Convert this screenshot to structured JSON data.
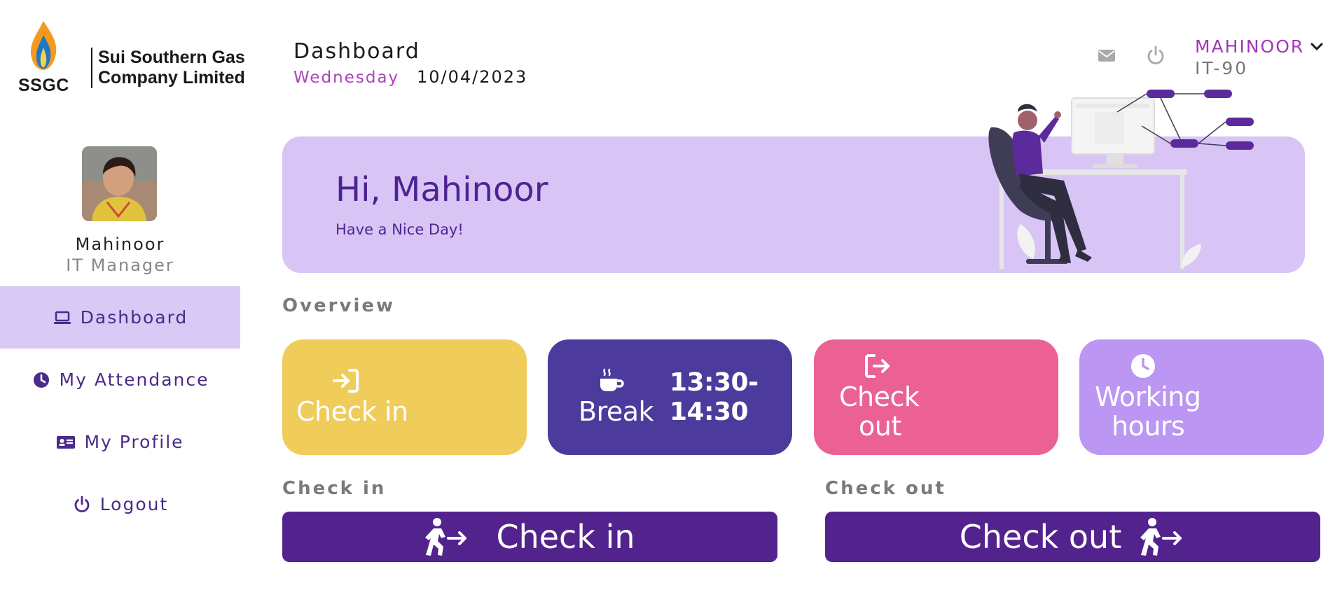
{
  "brand": {
    "abbr": "SSGC",
    "name_line1": "Sui Southern Gas",
    "name_line2": "Company Limited",
    "flame_outer": "#f59a1f",
    "flame_inner": "#1f78c8"
  },
  "profile": {
    "name": "Mahinoor",
    "role": "IT Manager"
  },
  "sidebar": {
    "items": [
      {
        "label": "Dashboard",
        "icon": "laptop-icon",
        "active": true
      },
      {
        "label": "My Attendance",
        "icon": "clock-icon",
        "active": false
      },
      {
        "label": "My Profile",
        "icon": "id-card-icon",
        "active": false
      },
      {
        "label": "Logout",
        "icon": "power-icon",
        "active": false
      }
    ]
  },
  "header": {
    "title": "Dashboard",
    "day": "Wednesday",
    "date": "10/04/2023",
    "user": "MAHINOOR",
    "code": "IT-90",
    "icons": [
      "mail-icon",
      "power-icon",
      "chevron-down-icon"
    ]
  },
  "banner": {
    "greeting": "Hi, Mahinoor",
    "subtitle": "Have a Nice Day!"
  },
  "overview": {
    "label": "Overview",
    "cards": [
      {
        "label": "Check in",
        "icon": "sign-in-icon",
        "color": "#f0cc5b"
      },
      {
        "label": "Break",
        "time_line1": "13:30-",
        "time_line2": "14:30",
        "icon": "coffee-icon",
        "color": "#4c3b9c"
      },
      {
        "label_line1": "Check",
        "label_line2": "out",
        "icon": "sign-out-icon",
        "color": "#eb6193"
      },
      {
        "label_line1": "Working",
        "label_line2": "hours",
        "icon": "clock-icon",
        "color": "#bb96f3"
      }
    ]
  },
  "actions": {
    "checkin_section": "Check in",
    "checkout_section": "Check out",
    "checkin_button": "Check in",
    "checkout_button": "Check out",
    "button_color": "#52238c",
    "icon": "person-walking-arrow-icon"
  },
  "colors": {
    "accent": "#52238c",
    "active_nav_bg": "#d8c9f5",
    "banner_bg": "#d8c5f6",
    "day_text": "#b03fbf",
    "header_user": "#a236b8"
  }
}
